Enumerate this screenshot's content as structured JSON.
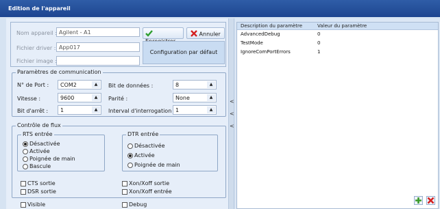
{
  "window": {
    "title": "Edition de l'appareil"
  },
  "device": {
    "name_label": "Nom appareil :",
    "name_value": "Agilent - A1",
    "driver_label": "Fichier driver :",
    "driver_value": "App017",
    "image_label": "Fichier image :",
    "image_value": ""
  },
  "buttons": {
    "save": "Enregistrer",
    "cancel": "Annuler",
    "default_config": "Configuration par défaut"
  },
  "comm": {
    "title": "Paramètres de communication",
    "port_label": "N° de Port :",
    "port_value": "COM2",
    "speed_label": "Vitesse :",
    "speed_value": "9600",
    "stopbit_label": "Bit d'arrêt :",
    "stopbit_value": "1",
    "databits_label": "Bit de données :",
    "databits_value": "8",
    "parity_label": "Parité :",
    "parity_value": "None",
    "interval_label": "Interval d'interrogation :",
    "interval_value": "1"
  },
  "flow": {
    "title": "Contrôle de flux",
    "rts": {
      "title": "RTS entrée",
      "options": [
        "Désactivée",
        "Activée",
        "Poignée de main",
        "Bascule"
      ],
      "selected": 0
    },
    "dtr": {
      "title": "DTR entrée",
      "options": [
        "Désactivée",
        "Activée",
        "Poignée de main"
      ],
      "selected": 1
    },
    "checks": {
      "cts": "CTS sortie",
      "dsr": "DSR sortie",
      "xon_out": "Xon/Xoff sortie",
      "xon_in": "Xon/Xoff entrée"
    }
  },
  "bottom": {
    "visible": "Visible",
    "debug": "Debug"
  },
  "params_table": {
    "headers": [
      "Description du paramètre",
      "Valeur du paramètre"
    ],
    "rows": [
      [
        "AdvancedDebug",
        "0"
      ],
      [
        "TestMode",
        "0"
      ],
      [
        "IgnoreComPortErrors",
        "1"
      ]
    ]
  },
  "icons": {
    "save": "checkmark-icon",
    "cancel": "x-icon",
    "add": "plus-icon",
    "remove": "delete-icon",
    "splitter": "chevron-left-icon"
  },
  "colors": {
    "title_bar": "#1d4590",
    "save_check": "#2e9e2e",
    "cancel_x": "#d42020",
    "add": "#3a9a2a"
  }
}
